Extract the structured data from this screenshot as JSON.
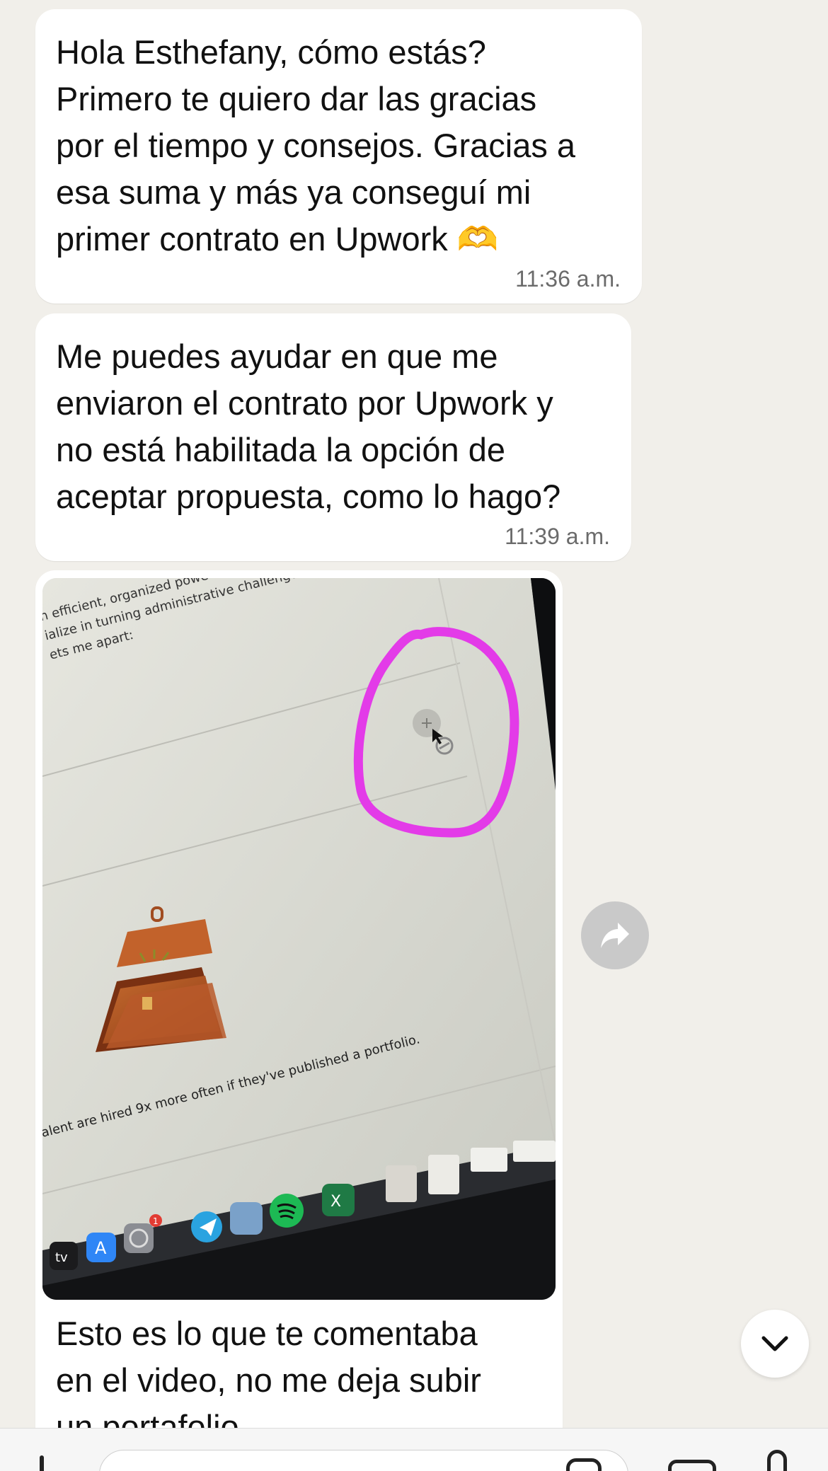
{
  "messages": [
    {
      "text": "Hola Esthefany, cómo estás?\nPrimero te quiero dar las gracias\npor el tiempo y consejos. Gracias a\nesa suma y más ya conseguí mi\nprimer contrato en Upwork 🫶",
      "time": "11:36 a.m."
    },
    {
      "text": "Me puedes ayudar en que me\nenviaron el contrato por Upwork y\nno está habilitada la opción de\naceptar propuesta, como lo hago?",
      "time": "11:39 a.m."
    },
    {
      "caption": "Esto es lo que te comentaba\nen el video, no me deja subir\nun portafolio",
      "photo": {
        "line1": "n efficient, organized powe",
        "line2": "ialize in turning administrative challenge",
        "line3": "ets me apart:",
        "banner": "alent are hired 9x more often if they've published a portfolio.",
        "dock_tv": "tv",
        "badge": "1",
        "excel_letter": "X"
      }
    }
  ],
  "icons": {
    "forward": "forward-arrow-icon",
    "scroll": "chevron-down-icon",
    "attach": "plus-icon",
    "sticker": "sticker-icon",
    "camera": "camera-icon",
    "mic": "microphone-icon"
  },
  "colors": {
    "background": "#f1efea",
    "bubble": "#ffffff",
    "highlight": "#e33be8",
    "time": "#6b6b6b"
  }
}
